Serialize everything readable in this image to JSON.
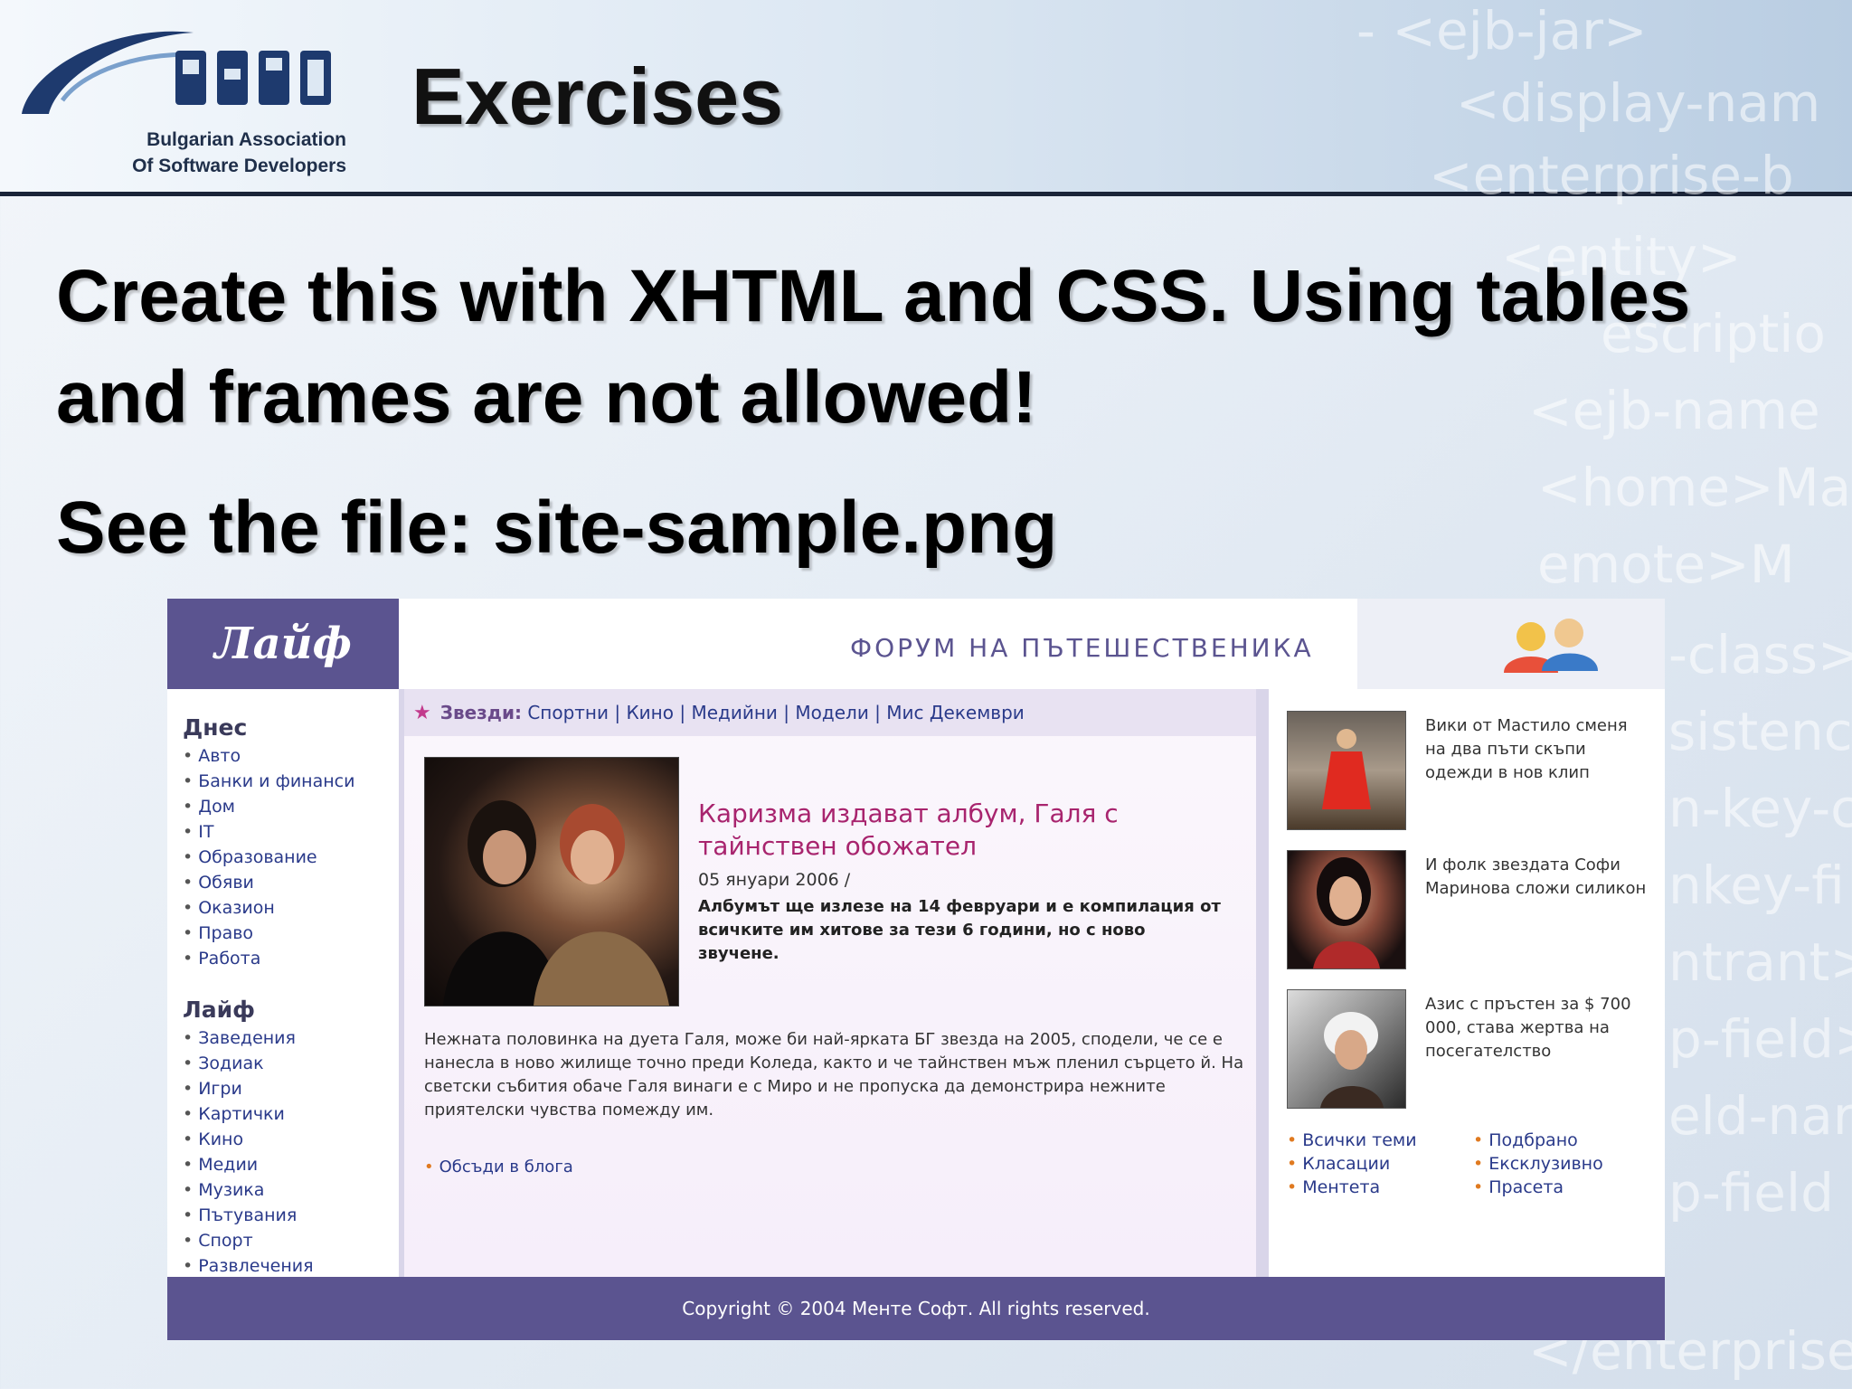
{
  "slide": {
    "title": "Exercises",
    "logo": {
      "org_line1": "Bulgarian Association",
      "org_line2": "Of Software Developers",
      "wordmark": "BASD"
    },
    "bullets": [
      "Create this with XHTML and CSS. Using tables and frames are not allowed!",
      "See the file: site-sample.png"
    ],
    "watermark": [
      "- <ejb-jar>",
      "<display-nam",
      "<enterprise-b",
      "<entity>",
      "escriptio",
      "<ejb-name",
      "<home>Ma",
      "emote>M",
      "-class>",
      "sistenc",
      "n-key-c",
      "nkey-fi",
      "ntrant>",
      "p-field>",
      "eld-nar",
      "p-field",
      "</enterprise-b"
    ]
  },
  "site": {
    "logo": "Лайф",
    "forum_banner": "ФОРУМ НА ПЪТЕШЕСТВЕНИКА",
    "nav": {
      "section1_title": "Днес",
      "section1_items": [
        "Авто",
        "Банки и финанси",
        "Дом",
        "IT",
        "Образование",
        "Обяви",
        "Оказион",
        "Право",
        "Работа"
      ],
      "section2_title": "Лайф",
      "section2_items": [
        "Заведения",
        "Зодиак",
        "Игри",
        "Картички",
        "Кино",
        "Медии",
        "Музика",
        "Пътувания",
        "Спорт",
        "Развлечения"
      ]
    },
    "stars_bar": {
      "label": "Звезди:",
      "links": [
        "Спортни",
        "Кино",
        "Медийни",
        "Модели",
        "Мис Декември"
      ],
      "separator": "|"
    },
    "article": {
      "title": "Каризма издават албум, Галя с тайнствен обожател",
      "date": "05 януари 2006 /",
      "lead": "Албумът ще излезе на 14 февруари и е компилация от всичките им хитове за тези 6 години, но с ново звучене.",
      "body": "Нежната половинка на дуета Галя, може би най-ярката БГ звезда на 2005, сподели, че се е нанесла в ново жилище точно преди Коледа, както и че тайнствен мъж пленил сърцето й. На светски събития обаче Галя винаги е с Миро и не пропуска да демонстрира нежните приятелски чувства помежду им.",
      "blog_link": "Обсъди в блога"
    },
    "sidebar": {
      "items": [
        "Вики от Мастило сменя на два пъти скъпи одежди в нов клип",
        "И фолк звездата Софи Маринова сложи силикон",
        "Азис с пръстен за $ 700 000, става жертва на посегателство"
      ],
      "links_left": [
        "Всички теми",
        "Класации",
        "Ментета"
      ],
      "links_right": [
        "Подбрано",
        "Ексклузивно",
        "Прасета"
      ]
    },
    "footer": "Copyright © 2004 Менте Софт. All rights reserved."
  },
  "colors": {
    "site_accent": "#5b5490",
    "headline": "#a8246e",
    "link": "#2a3a8a",
    "bullet_orange": "#e07a20"
  }
}
